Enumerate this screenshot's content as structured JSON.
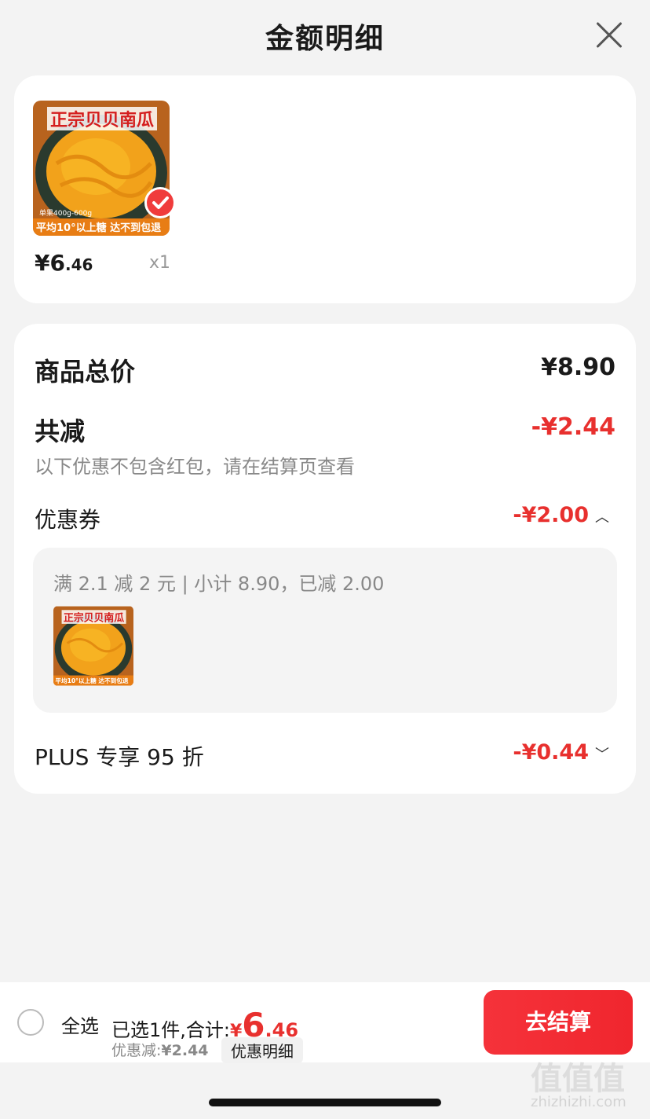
{
  "header": {
    "title": "金额明细"
  },
  "product": {
    "image_banner_text": "正宗贝贝南瓜",
    "image_bottom_text": "平均10°以上糖 达不到包退",
    "image_small_text": "单果400g-600g",
    "price_int": "¥6",
    "price_dec": ".46",
    "quantity": "x1",
    "selected": true
  },
  "detail": {
    "total_label": "商品总价",
    "total_value": "¥8.90",
    "reduce_label": "共减",
    "reduce_value": "-¥2.44",
    "note": "以下优惠不包含红包，请在结算页查看",
    "coupon_label": "优惠券",
    "coupon_value": "-¥2.00",
    "coupon_rule": "满 2.1 减 2 元 | 小计 8.90，已减 2.00",
    "plus_label": "PLUS 专享 95 折",
    "plus_value": "-¥0.44"
  },
  "bottom": {
    "select_all": "全选",
    "summary_prefix": "已选1件,合计:",
    "total_symbol": "¥",
    "total_int": "6",
    "total_dec": ".46",
    "discount_prefix": "优惠减:",
    "discount_amount": "¥2.44",
    "detail_chip": "优惠明细",
    "checkout": "去结算"
  },
  "watermark": {
    "text": "值值值",
    "sub": "zhizhizhi.com"
  },
  "colors": {
    "accent_red": "#e8302e",
    "background": "#f3f3f3"
  }
}
